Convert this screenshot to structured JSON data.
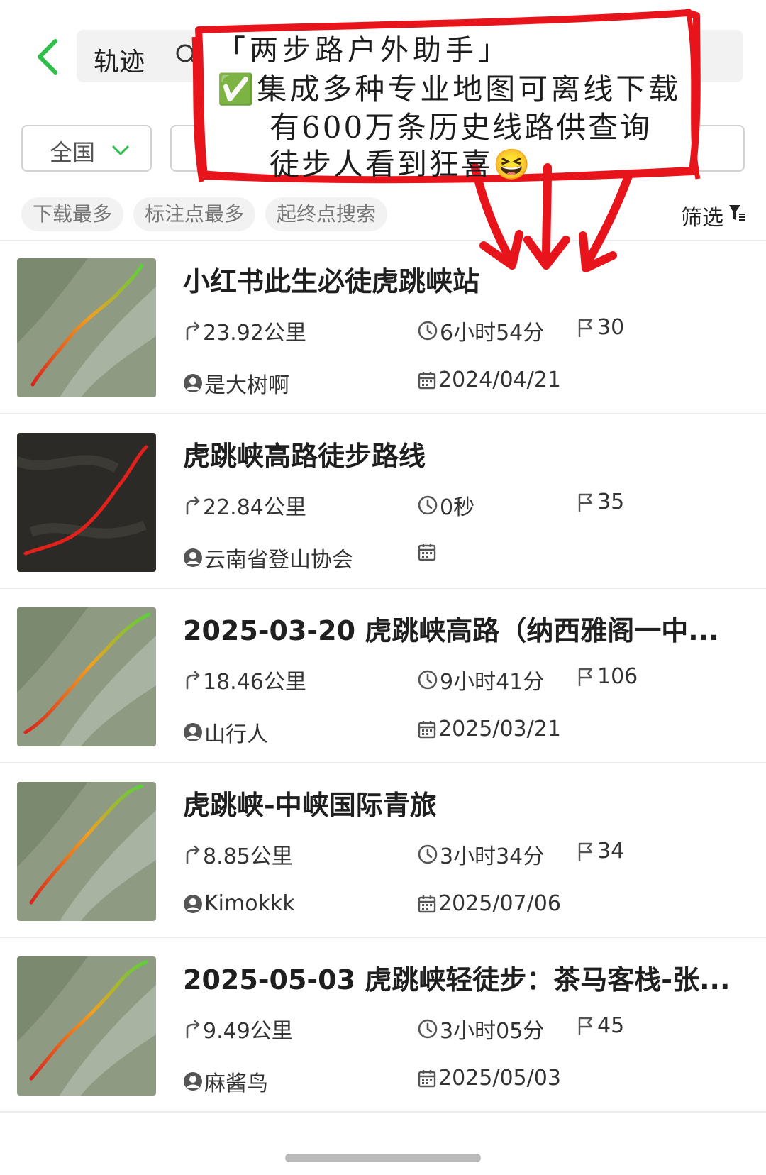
{
  "header": {
    "search_label": "轨迹"
  },
  "region": {
    "selected": "全国"
  },
  "chips": [
    "下载最多",
    "标注点最多",
    "起终点搜索"
  ],
  "filter_label": "筛选",
  "overlay": {
    "line1": "「两步路户外助手」",
    "line2": "集成多种专业地图可离线下载",
    "line3": "有600万条历史线路供查询",
    "line4": "徒步人看到狂喜😆",
    "check_icon": "✅"
  },
  "items": [
    {
      "title": "小红书此生必徒虎跳峡站",
      "distance": "23.92公里",
      "duration": "6小时54分",
      "markers": "30",
      "author": "是大树啊",
      "date": "2024/04/21",
      "map_style": "terrain"
    },
    {
      "title": "虎跳峡高路徒步路线",
      "distance": "22.84公里",
      "duration": "0秒",
      "markers": "35",
      "author": "云南省登山协会",
      "date": "",
      "map_style": "satellite"
    },
    {
      "title": "2025-03-20 虎跳峡高路（纳西雅阁一中...",
      "distance": "18.46公里",
      "duration": "9小时41分",
      "markers": "106",
      "author": "山行人",
      "date": "2025/03/21",
      "map_style": "terrain"
    },
    {
      "title": "虎跳峡-中峡国际青旅",
      "distance": "8.85公里",
      "duration": "3小时34分",
      "markers": "34",
      "author": "Kimokkk",
      "date": "2025/07/06",
      "map_style": "terrain"
    },
    {
      "title": "2025-05-03 虎跳峡轻徒步：茶马客栈-张...",
      "distance": "9.49公里",
      "duration": "3小时05分",
      "markers": "45",
      "author": "麻酱鸟",
      "date": "2025/05/03",
      "map_style": "terrain"
    }
  ],
  "colors": {
    "accent": "#2dbf4a",
    "annotation": "#e8141b",
    "chip_bg": "#f1f2f1"
  }
}
